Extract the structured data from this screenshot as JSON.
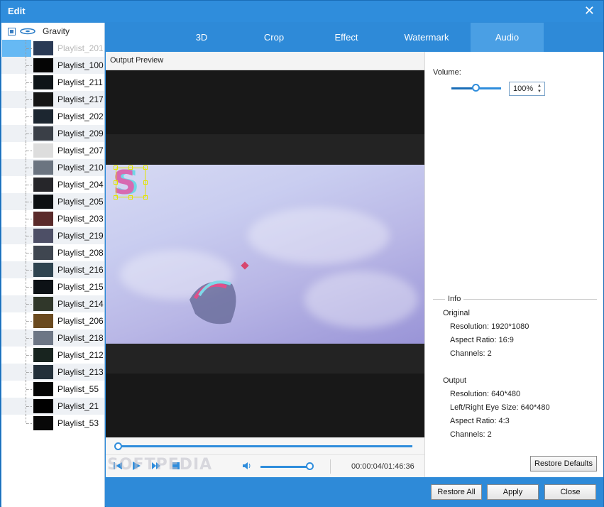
{
  "window": {
    "title": "Edit",
    "close_glyph": "✕"
  },
  "tree": {
    "root_label": "Gravity",
    "items": [
      {
        "label": "Playlist_201",
        "thumb": "#2a3a55"
      },
      {
        "label": "Playlist_100",
        "thumb": "#050505"
      },
      {
        "label": "Playlist_211",
        "thumb": "#0e1418"
      },
      {
        "label": "Playlist_217",
        "thumb": "#151515"
      },
      {
        "label": "Playlist_202",
        "thumb": "#1c2630"
      },
      {
        "label": "Playlist_209",
        "thumb": "#3a3f47"
      },
      {
        "label": "Playlist_207",
        "thumb": "#dddddd"
      },
      {
        "label": "Playlist_210",
        "thumb": "#6b7480"
      },
      {
        "label": "Playlist_204",
        "thumb": "#26262a"
      },
      {
        "label": "Playlist_205",
        "thumb": "#0c0f12"
      },
      {
        "label": "Playlist_203",
        "thumb": "#5a2a2a"
      },
      {
        "label": "Playlist_219",
        "thumb": "#4d4f66"
      },
      {
        "label": "Playlist_208",
        "thumb": "#3f4650"
      },
      {
        "label": "Playlist_216",
        "thumb": "#2f4450"
      },
      {
        "label": "Playlist_215",
        "thumb": "#0d1216"
      },
      {
        "label": "Playlist_214",
        "thumb": "#30372a"
      },
      {
        "label": "Playlist_206",
        "thumb": "#6a4a1f"
      },
      {
        "label": "Playlist_218",
        "thumb": "#6d7685"
      },
      {
        "label": "Playlist_212",
        "thumb": "#18241f"
      },
      {
        "label": "Playlist_213",
        "thumb": "#23303a"
      },
      {
        "label": "Playlist_55",
        "thumb": "#050505"
      },
      {
        "label": "Playlist_21",
        "thumb": "#000000"
      },
      {
        "label": "Playlist_53",
        "thumb": "#080808"
      }
    ]
  },
  "tabs": [
    {
      "label": "3D"
    },
    {
      "label": "Crop"
    },
    {
      "label": "Effect"
    },
    {
      "label": "Watermark"
    },
    {
      "label": "Audio",
      "active": true
    }
  ],
  "preview": {
    "title": "Output Preview",
    "watermark_text": "S",
    "overlay_text": "SOFTPEDIA",
    "time": "00:00:04/01:46:36"
  },
  "audio": {
    "volume_label": "Volume:",
    "volume_value": "100%",
    "volume_level": 0.5
  },
  "info": {
    "title": "Info",
    "original_heading": "Original",
    "original": [
      "Resolution: 1920*1080",
      "Aspect Ratio: 16:9",
      "Channels: 2"
    ],
    "output_heading": "Output",
    "output": [
      "Resolution: 640*480",
      "Left/Right Eye Size: 640*480",
      "Aspect Ratio: 4:3",
      "Channels: 2"
    ]
  },
  "buttons": {
    "restore_defaults": "Restore Defaults",
    "restore_all": "Restore All",
    "apply": "Apply",
    "close": "Close"
  },
  "colors": {
    "accent": "#2e8ad8",
    "tab_active": "#4a9fe4",
    "selection": "#66b9f4"
  }
}
